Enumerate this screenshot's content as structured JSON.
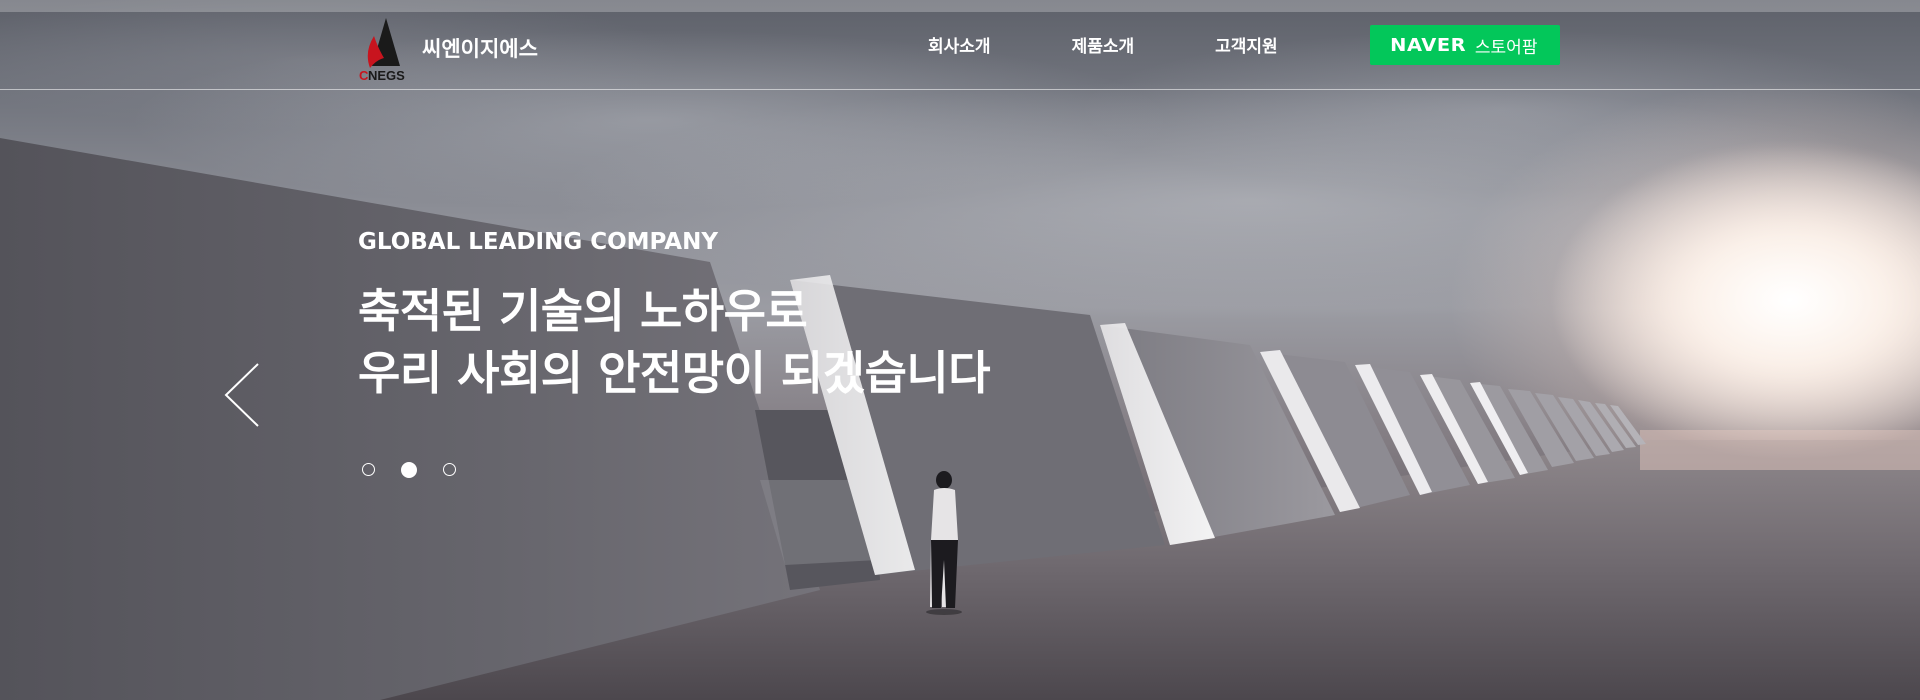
{
  "brand": {
    "logo_text": "씨엔이지에스",
    "logo_mark_label": "CNEGS",
    "logo_mark_icon": "cnegs-rocket-logo-icon"
  },
  "nav": {
    "items": [
      {
        "label": "회사소개"
      },
      {
        "label": "제품소개"
      },
      {
        "label": "고객지원"
      }
    ]
  },
  "store_button": {
    "naver_logo": "NAVER",
    "label": "스토어팜",
    "color": "#03c75a"
  },
  "hero": {
    "subtitle": "GLOBAL LEADING COMPANY",
    "title_line1": "축적된 기술의 노하우로",
    "title_line2": "우리 사회의 안전망이 되겠습니다",
    "prev_icon": "chevron-left-icon"
  },
  "slider": {
    "total": 3,
    "active_index": 1
  }
}
